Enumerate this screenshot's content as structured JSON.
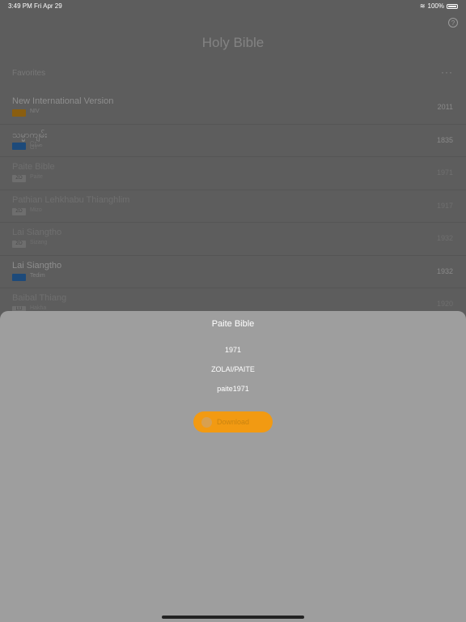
{
  "status": {
    "time": "3:49 PM",
    "date": "Fri Apr 29",
    "battery": "100%"
  },
  "header": {
    "title": "Holy Bible"
  },
  "favorites": {
    "label": "Favorites",
    "more": "···"
  },
  "versions": [
    {
      "name": "New International Version",
      "badge": "",
      "lang": "NIV",
      "year": "2011"
    },
    {
      "name": "သမ္မာကျမ်း",
      "badge": "",
      "lang": "မြန်မာ",
      "year": "1835"
    },
    {
      "name": "Paite Bible",
      "badge": "ZO",
      "lang": "Paite",
      "year": "1971"
    },
    {
      "name": "Pathian Lehkhabu Thianghlim",
      "badge": "ZO",
      "lang": "Mizo",
      "year": "1917"
    },
    {
      "name": "Lai Siangtho",
      "badge": "ZO",
      "lang": "Sizang",
      "year": "1932"
    },
    {
      "name": "Lai Siangtho",
      "badge": "",
      "lang": "Tedim",
      "year": "1932"
    },
    {
      "name": "Baibal Thiang",
      "badge": "LU",
      "lang": "Hakha",
      "year": "1920"
    }
  ],
  "sheet": {
    "title": "Paite Bible",
    "year": "1971",
    "language": "ZOLAI/PAITE",
    "code": "paite1971",
    "download_label": "Download"
  }
}
